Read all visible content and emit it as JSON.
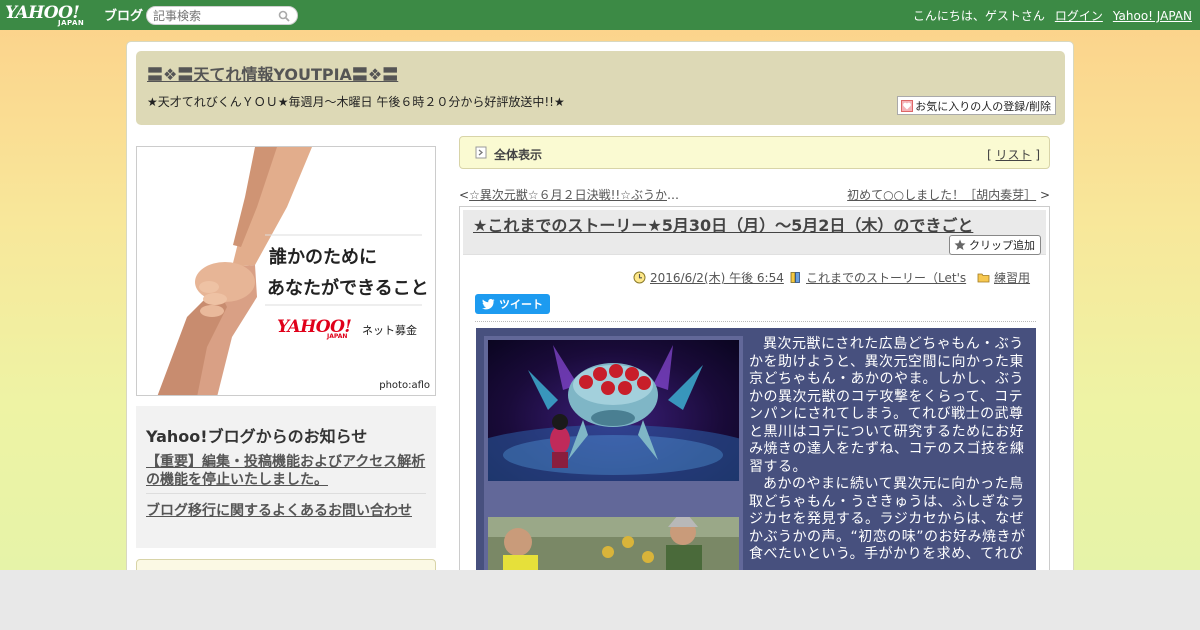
{
  "topbar": {
    "brand_main": "YAHOO!",
    "brand_sub": "JAPAN",
    "brand_blog": "ブログ",
    "search_placeholder": "記事検索",
    "greeting": "こんにちは、ゲストさん",
    "login": "ログイン",
    "yahoo_japan": "Yahoo! JAPAN"
  },
  "header": {
    "title": "〓❖〓天てれ情報YOUTPIA〓❖〓",
    "description": "★天才てれびくんＹＯＵ★毎週月～木曜日 午後６時２０分から好評放送中!!★",
    "fav_button": "お気に入りの人の登録/削除"
  },
  "ad": {
    "line1": "誰かのために",
    "line2": "あなたができること",
    "logo_main": "YAHOO!",
    "logo_sub": "JAPAN",
    "logo_suffix": "ネット募金",
    "credit": "photo:aflo"
  },
  "notice": {
    "heading": "Yahoo!ブログからのお知らせ",
    "item1": "【重要】編集・投稿機能およびアクセス解析の機能を停止いたしました。",
    "item2": "ブログ移行に関するよくあるお問い合わせ"
  },
  "main_bar": {
    "label": "全体表示",
    "list_open": "[ ",
    "list_link": "リスト",
    "list_close": " ]"
  },
  "nav": {
    "prev_mark": "<",
    "prev_title": "☆異次元獣☆６月２日決戦!!☆ぶうか",
    "prev_ellipsis": "…",
    "next_title": "初めて○○しました！［胡内奏芽］",
    "next_mark": ">"
  },
  "article": {
    "title": "★これまでのストーリー★5月30日（月）～5月2日（木）のできごと",
    "clip_button": "クリップ追加",
    "date": "2016/6/2(木) 午後 6:54",
    "category": "これまでのストーリー（Let's",
    "folder": "練習用",
    "tweet": "ツイート",
    "paragraph1": "異次元獣にされた広島どちゃもん・ぶうかを助けようと、異次元空間に向かった東京どちゃもん・あかのやま。しかし、ぶうかの異次元獣のコテ攻撃をくらって、コテンパンにされてしまう。てれび戦士の武尊と黒川はコテについて研究するためにお好み焼きの達人をたずね、コテのスゴ技を練習する。",
    "paragraph2": "あかのやまに続いて異次元に向かった鳥取どちゃもん・うさきゅうは、ふしぎなラジカセを発見する。ラジカセからは、なぜかぶうかの声。“初恋の味”のお好み焼きが食べたいという。手がかりを求め、てれび"
  }
}
